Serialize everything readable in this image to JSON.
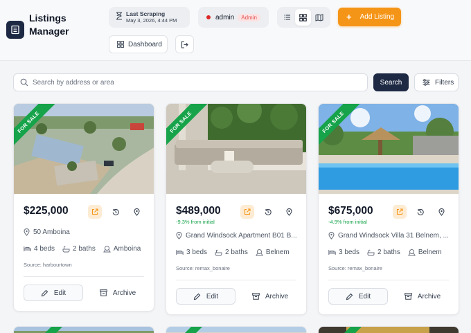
{
  "app": {
    "title": "Listings Manager"
  },
  "header": {
    "scrape_label": "Last Scraping",
    "scrape_time": "May 3, 2026, 4:44 PM",
    "user": "admin",
    "role_badge": "Admin",
    "add_listing": "Add Listing",
    "dashboard": "Dashboard"
  },
  "search": {
    "placeholder": "Search by address or area",
    "button": "Search",
    "filters": "Filters"
  },
  "listing_ribbon": "FOR SALE",
  "listings": [
    {
      "price": "$225,000",
      "change": "",
      "address": "50 Amboina",
      "beds": "4 beds",
      "baths": "2 baths",
      "area": "Amboina",
      "source": "Source: harbourtown",
      "edit": "Edit",
      "archive": "Archive"
    },
    {
      "price": "$489,000",
      "change": "-9.3% from initial",
      "address": "Grand Windsock Apartment B01 B...",
      "beds": "3 beds",
      "baths": "2 baths",
      "area": "Belnem",
      "source": "Source: remax_bonaire",
      "edit": "Edit",
      "archive": "Archive"
    },
    {
      "price": "$675,000",
      "change": "-4.9% from initial",
      "address": "Grand Windsock Villa 31 Belnem, ...",
      "beds": "3 beds",
      "baths": "2 baths",
      "area": "Belnem",
      "source": "Source: remax_bonaire",
      "edit": "Edit",
      "archive": "Archive"
    }
  ],
  "colors": {
    "accent": "#f59517",
    "primary": "#1e2a44",
    "ribbon": "#16a34a",
    "danger": "#dc2626"
  },
  "icons": [
    "listings-logo-icon",
    "hourglass-icon",
    "list-view-icon",
    "grid-view-icon",
    "map-view-icon",
    "logout-icon",
    "search-icon",
    "filters-icon",
    "external-link-icon",
    "history-icon",
    "map-pin-icon",
    "bed-icon",
    "bath-icon",
    "area-icon",
    "pencil-icon",
    "archive-icon"
  ]
}
